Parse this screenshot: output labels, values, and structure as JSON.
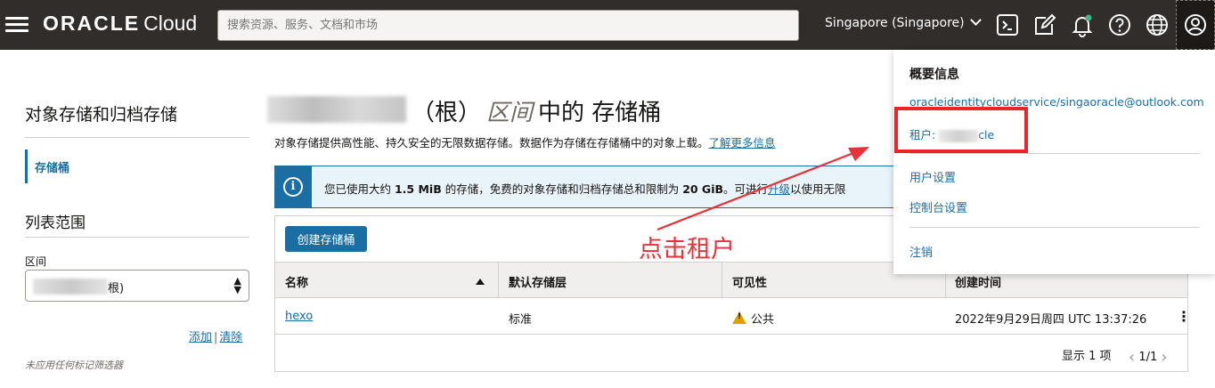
{
  "topbar": {
    "logo_brand": "ORACLE",
    "logo_product": "Cloud",
    "search_placeholder": "搜索资源、服务、文档和市场",
    "region": "Singapore (Singapore)",
    "icons": [
      "cloud-shell-icon",
      "edit-icon",
      "bell-icon",
      "help-icon",
      "globe-icon",
      "profile-icon"
    ]
  },
  "sidebar": {
    "title": "对象存储和归档存储",
    "active_item": "存储桶",
    "list_scope": "列表范围",
    "compartment_label": "区间",
    "compartment_value_suffix": "根)",
    "add_link": "添加",
    "separator": "|",
    "clear_link": "清除",
    "filter_note": "未应用任何标记筛选器"
  },
  "main": {
    "title_prefix": "（根）",
    "title_italic": "区间",
    "title_suffix": "中的 存储桶",
    "desc": "对象存储提供高性能、持久安全的无限数据存储。数据作为存储在存储桶中的对象上载。",
    "learn_more": "了解更多信息",
    "info": {
      "pre": "您已使用大约 ",
      "used": "1.5 MiB",
      "mid": " 的存储，免费的对象存储和归档存储总和限制为 ",
      "limit": "20 GiB",
      "post": "。可进行",
      "upgrade": "升级",
      "tail": "以使用无限"
    },
    "create_button": "创建存储桶",
    "columns": [
      "名称",
      "默认存储层",
      "可见性",
      "创建时间"
    ],
    "rows": [
      {
        "name": "hexo",
        "tier": "标准",
        "visibility": "公共",
        "created": "2022年9月29日周四 UTC 13:37:26"
      }
    ],
    "footer_count": "显示 1 项",
    "pager": "1/1"
  },
  "dropdown": {
    "title": "概要信息",
    "email": "oracleidentitycloudservice/singaoracle@outlook.com",
    "tenancy_prefix": "租户: ",
    "tenancy_suffix": "cle",
    "user_settings": "用户设置",
    "console_settings": "控制台设置",
    "sign_out": "注销"
  },
  "annotation": {
    "text": "点击租户",
    "color": "#e8323a"
  },
  "colors": {
    "topbar": "#312d2a",
    "accent": "#1a6ea3",
    "highlight": "#e8262b"
  }
}
